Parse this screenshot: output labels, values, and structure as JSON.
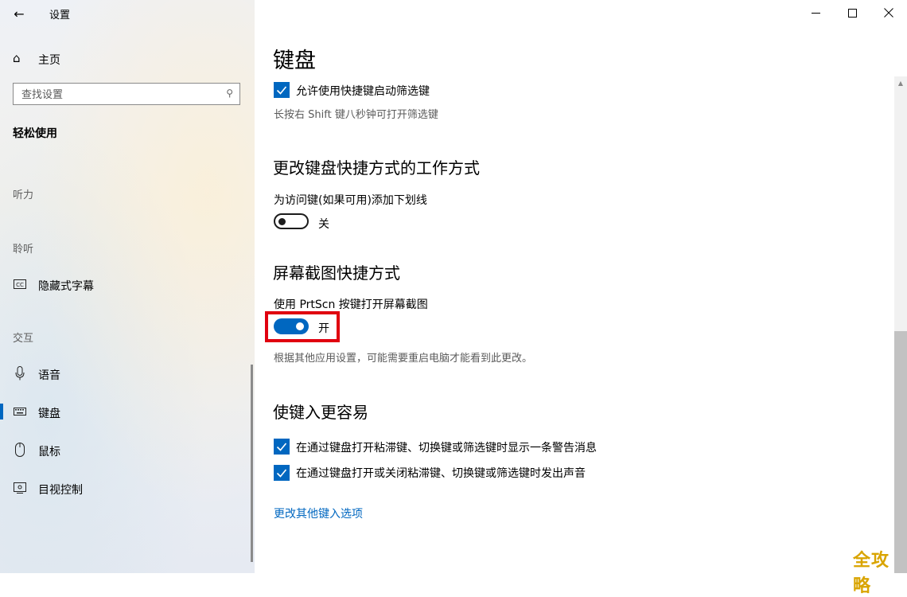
{
  "window": {
    "title": "设置",
    "minimize_glyph": "—",
    "maximize_glyph": "☐",
    "close_glyph": "✕"
  },
  "sidebar": {
    "back_glyph": "←",
    "home": {
      "icon": "home-icon",
      "glyph": "⌂",
      "label": "主页"
    },
    "search": {
      "placeholder": "查找设置",
      "icon": "search-icon",
      "glyph": "⚲"
    },
    "section": "轻松使用",
    "groups": {
      "hearing_vision": "听力",
      "listen": "聆听",
      "interaction": "交互"
    },
    "items": [
      {
        "id": "captions",
        "label": "隐藏式字幕",
        "icon": "closed-captions-icon",
        "glyph": "CC"
      },
      {
        "id": "speech",
        "label": "语音",
        "icon": "microphone-icon",
        "glyph": "🎙"
      },
      {
        "id": "keyboard",
        "label": "键盘",
        "icon": "keyboard-icon",
        "glyph": "⌨",
        "active": true
      },
      {
        "id": "mouse",
        "label": "鼠标",
        "icon": "mouse-icon",
        "glyph": "🖱"
      },
      {
        "id": "eye_control",
        "label": "目视控制",
        "icon": "eye-control-icon",
        "glyph": "◫"
      }
    ]
  },
  "main": {
    "title": "键盘",
    "filter_keys_checkbox": {
      "label": "允许使用快捷键启动筛选键",
      "checked": true
    },
    "filter_keys_desc": "长按右 Shift 键八秒钟可打开筛选键",
    "shortcuts_heading": "更改键盘快捷方式的工作方式",
    "underline_label": "为访问键(如果可用)添加下划线",
    "underline_toggle": {
      "state": "关",
      "on": false
    },
    "screenshot_heading": "屏幕截图快捷方式",
    "prtscn_label": "使用 PrtScn 按键打开屏幕截图",
    "prtscn_toggle": {
      "state": "开",
      "on": true
    },
    "prtscn_desc": "根据其他应用设置，可能需要重启电脑才能看到此更改。",
    "typing_heading": "使键入更容易",
    "warning_checkbox": {
      "label": "在通过键盘打开粘滞键、切换键或筛选键时显示一条警告消息",
      "checked": true
    },
    "sound_checkbox": {
      "label": "在通过键盘打开或关闭粘滞键、切换键或筛选键时发出声音",
      "checked": true
    },
    "more_link": "更改其他键入选项"
  },
  "watermark": "全攻略",
  "colors": {
    "accent": "#0067c0",
    "highlight_box": "#e0000f"
  }
}
